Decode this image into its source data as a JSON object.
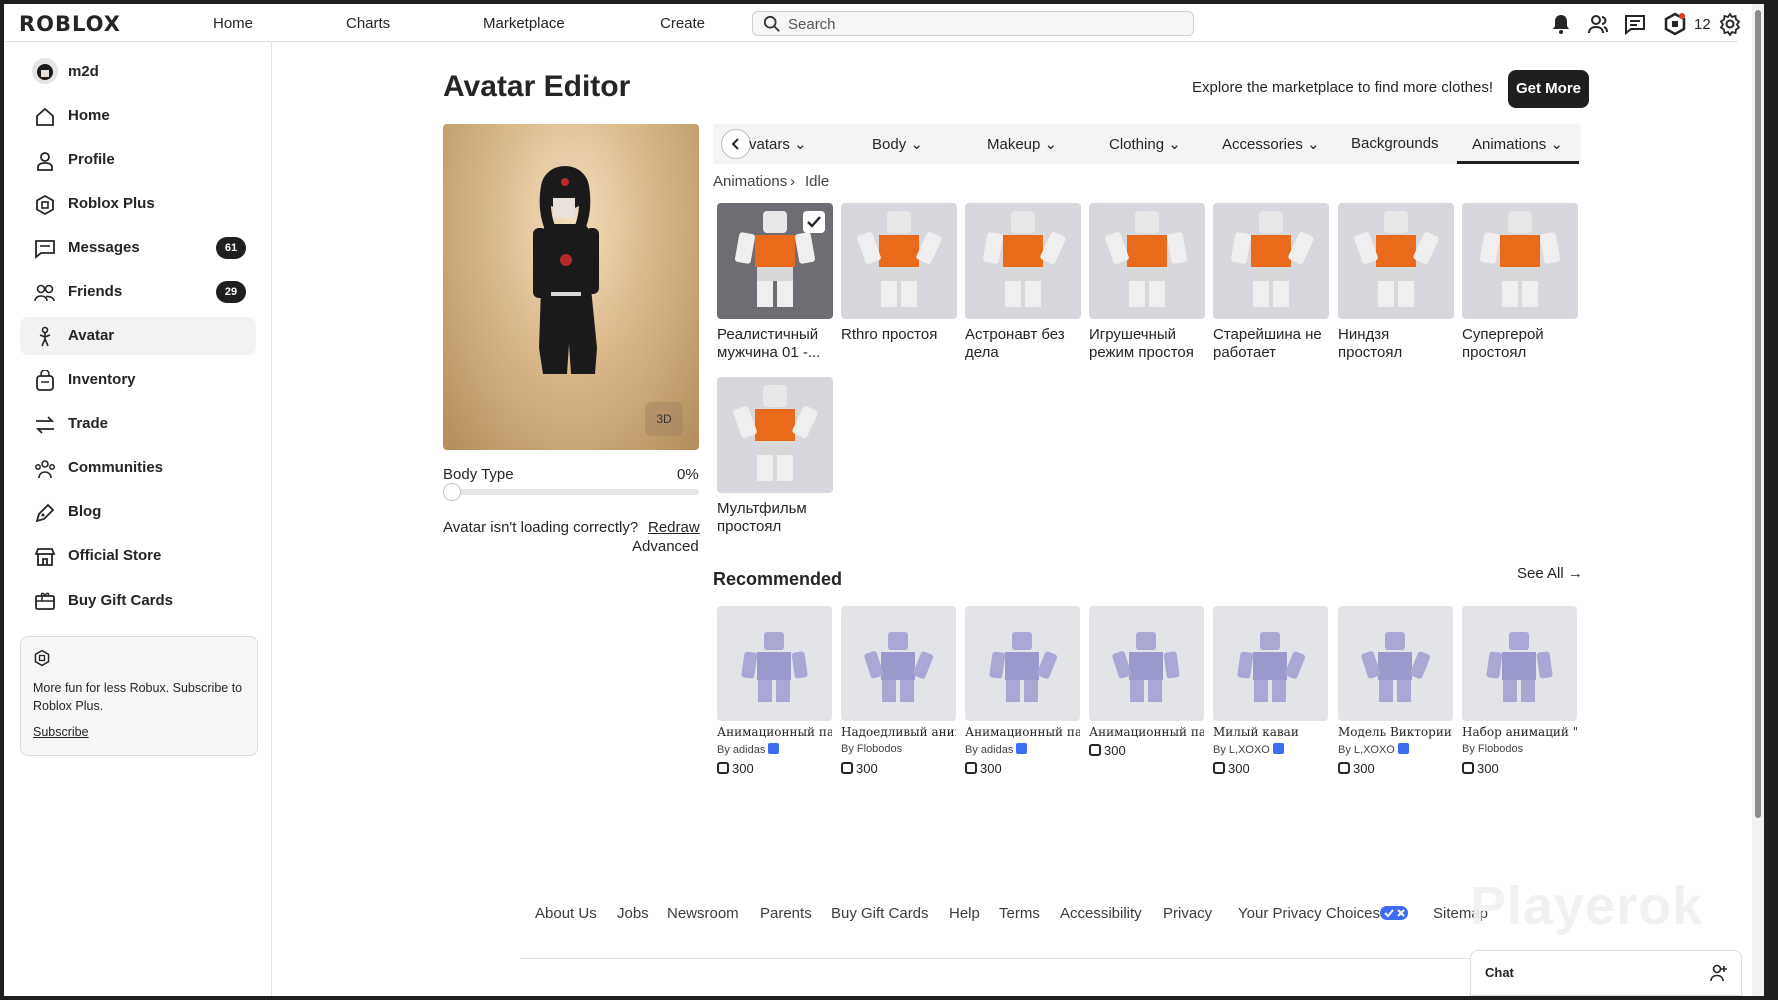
{
  "header": {
    "logo": "ROBLOX",
    "nav": [
      "Home",
      "Charts",
      "Marketplace",
      "Create"
    ],
    "search_placeholder": "Search",
    "robux": "12"
  },
  "sidebar": {
    "username": "m2d",
    "items": [
      {
        "label": "Home",
        "icon": "home-icon"
      },
      {
        "label": "Profile",
        "icon": "profile-icon"
      },
      {
        "label": "Roblox Plus",
        "icon": "roblox-plus-icon"
      },
      {
        "label": "Messages",
        "icon": "messages-icon",
        "badge": "61"
      },
      {
        "label": "Friends",
        "icon": "friends-icon",
        "badge": "29"
      },
      {
        "label": "Avatar",
        "icon": "avatar-icon",
        "active": true
      },
      {
        "label": "Inventory",
        "icon": "inventory-icon"
      },
      {
        "label": "Trade",
        "icon": "trade-icon"
      },
      {
        "label": "Communities",
        "icon": "communities-icon"
      },
      {
        "label": "Blog",
        "icon": "blog-icon"
      },
      {
        "label": "Official Store",
        "icon": "store-icon"
      },
      {
        "label": "Buy Gift Cards",
        "icon": "gift-card-icon"
      }
    ],
    "promo": {
      "text": "More fun for less Robux. Subscribe to Roblox Plus.",
      "link": "Subscribe"
    }
  },
  "main": {
    "title": "Avatar Editor",
    "explore_text": "Explore the marketplace to find more clothes!",
    "get_more": "Get More",
    "preview_3d": "3D",
    "body_type_label": "Body Type",
    "body_type_value": "0%",
    "loading_question": "Avatar isn't loading correctly?",
    "redraw": "Redraw",
    "advanced": "Advanced",
    "tabs": [
      "vatars",
      "Body",
      "Makeup",
      "Clothing",
      "Accessories",
      "Backgrounds",
      "Animations"
    ],
    "active_tab": "Animations",
    "breadcrumb": [
      "Animations",
      "Idle"
    ],
    "items": [
      {
        "name": "Реалистичный мужчина 01 -...",
        "selected": true
      },
      {
        "name": "Rthro простоя"
      },
      {
        "name": "Астронавт без дела"
      },
      {
        "name": "Игрушечный режим простоя"
      },
      {
        "name": "Старейшина не работает"
      },
      {
        "name": "Ниндзя простоял"
      },
      {
        "name": "Супергерой простоял"
      },
      {
        "name": "Мультфильм простоял"
      }
    ],
    "recommended_title": "Recommended",
    "see_all": "See All",
    "recommended": [
      {
        "name": "Анимационный пакет",
        "by": "adidas",
        "verified": true,
        "price": "300"
      },
      {
        "name": "Надоедливый анимация",
        "by": "Flobodos",
        "verified": false,
        "price": "300"
      },
      {
        "name": "Анимационный пакет",
        "by": "adidas",
        "verified": true,
        "price": "300"
      },
      {
        "name": "Анимационный пакет",
        "by": "",
        "verified": false,
        "price": "300"
      },
      {
        "name": "Милый каваи",
        "by": "L,XOXO",
        "verified": true,
        "price": "300"
      },
      {
        "name": "Модель Виктории",
        "by": "L,XOXO",
        "verified": true,
        "price": "300"
      },
      {
        "name": "Набор анимаций \"Ми",
        "by": "Flobodos",
        "verified": false,
        "price": "300"
      }
    ]
  },
  "footer": {
    "links": [
      "About Us",
      "Jobs",
      "Newsroom",
      "Parents",
      "Buy Gift Cards",
      "Help",
      "Terms",
      "Accessibility",
      "Privacy",
      "Your Privacy Choices",
      "Sitemap"
    ]
  },
  "watermark": "Playerok",
  "chat": {
    "label": "Chat"
  },
  "colors": {
    "accent": "#1f1f1f",
    "verified": "#3d6bf2",
    "card_bg": "#d7d8de"
  }
}
